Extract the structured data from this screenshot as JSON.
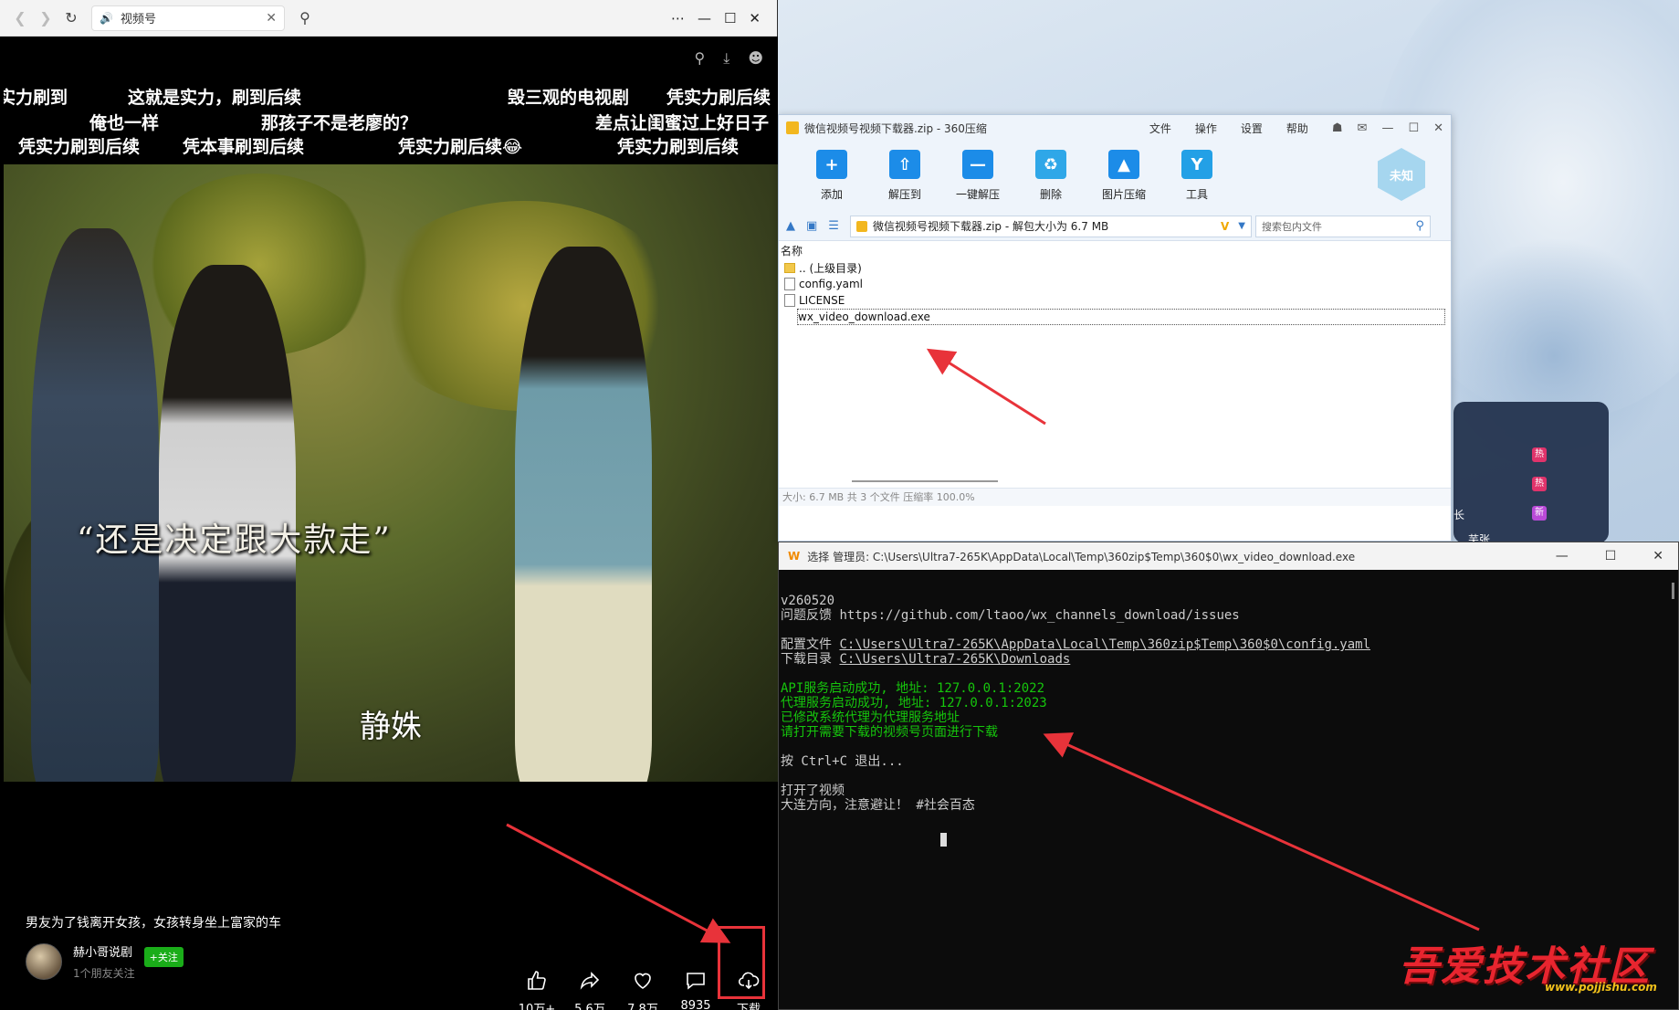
{
  "browser": {
    "tab_title": "视频号",
    "video": {
      "danmaku": [
        "实力刷到",
        "这就是实力，刷到后续",
        "毁三观的电视剧",
        "凭实力刷后续",
        "俺也一样",
        "那孩子不是老廖的？",
        "差点让闺蜜过上好日子",
        "凭实力刷到后续",
        "凭本事刷到后续",
        "凭实力刷后续😂",
        "凭实力刷到后续"
      ],
      "dialogue": "“还是决定跟大款走”",
      "name_caption": "静姝",
      "title": "男友为了钱离开女孩，女孩转身坐上富家的车",
      "author_name": "赫小哥说剧",
      "author_sub": "1个朋友关注",
      "follow_label": "+关注",
      "actions": [
        {
          "icon": "thumbs-up-icon",
          "label": "10万+"
        },
        {
          "icon": "share-icon",
          "label": "5.6万"
        },
        {
          "icon": "heart-icon",
          "label": "7.8万"
        },
        {
          "icon": "comment-icon",
          "label": "8935"
        },
        {
          "icon": "cloud-download-icon",
          "label": "下载"
        }
      ]
    }
  },
  "zip": {
    "title": "微信视频号视频下载器.zip - 360压缩",
    "menu": [
      "文件",
      "操作",
      "设置",
      "帮助"
    ],
    "tools": [
      {
        "icon": "add-icon",
        "label": "添加"
      },
      {
        "icon": "extract-to-icon",
        "label": "解压到"
      },
      {
        "icon": "one-click-extract-icon",
        "label": "一键解压"
      },
      {
        "icon": "delete-icon",
        "label": "删除"
      },
      {
        "icon": "image-compress-icon",
        "label": "图片压缩"
      },
      {
        "icon": "tools-icon",
        "label": "工具"
      }
    ],
    "unknown_badge": "未知",
    "path": "微信视频号视频下载器.zip - 解包大小为 6.7 MB",
    "search_placeholder": "搜索包内文件",
    "column_name": "名称",
    "files": [
      {
        "name": ".. (上级目录)",
        "type": "folder"
      },
      {
        "name": "config.yaml",
        "type": "file"
      },
      {
        "name": "LICENSE",
        "type": "file"
      },
      {
        "name": "wx_video_download.exe",
        "type": "file"
      }
    ],
    "status": "大小: 6.7 MB 共 3 个文件 压缩率 100.0%"
  },
  "terminal": {
    "title": "选择 管理员: C:\\Users\\Ultra7-265K\\AppData\\Local\\Temp\\360zip$Temp\\360$0\\wx_video_download.exe",
    "lines": {
      "version": "v260520",
      "feedback_label": "问题反馈 ",
      "feedback_url": "https://github.com/ltaoo/wx_channels_download/issues",
      "config_label": "配置文件 ",
      "config_path": "C:\\Users\\Ultra7-265K\\AppData\\Local\\Temp\\360zip$Temp\\360$0\\config.yaml",
      "download_label": "下载目录 ",
      "download_path": "C:\\Users\\Ultra7-265K\\Downloads",
      "api_ok": "API服务启动成功, 地址: 127.0.0.1:2022",
      "proxy_ok": "代理服务启动成功, 地址: 127.0.0.1:2023",
      "proxy_set": "已修改系统代理为代理服务地址",
      "open_hint": "请打开需要下载的视频号页面进行下载",
      "exit_hint": "按 Ctrl+C 退出...",
      "opened": "打开了视频",
      "video_name": "大连方向，注意避让！ #社会百态"
    }
  },
  "desktop": {
    "badges": [
      "热",
      "热",
      "新"
    ],
    "snippet_1": "长",
    "snippet_2": "芜张"
  },
  "watermark": {
    "text": "吾爱技术社区",
    "url": "www.pojjishu.com"
  },
  "colors": {
    "accent_green": "#1aad19",
    "arrow_red": "#e8333a",
    "terminal_green": "#16c60c"
  }
}
